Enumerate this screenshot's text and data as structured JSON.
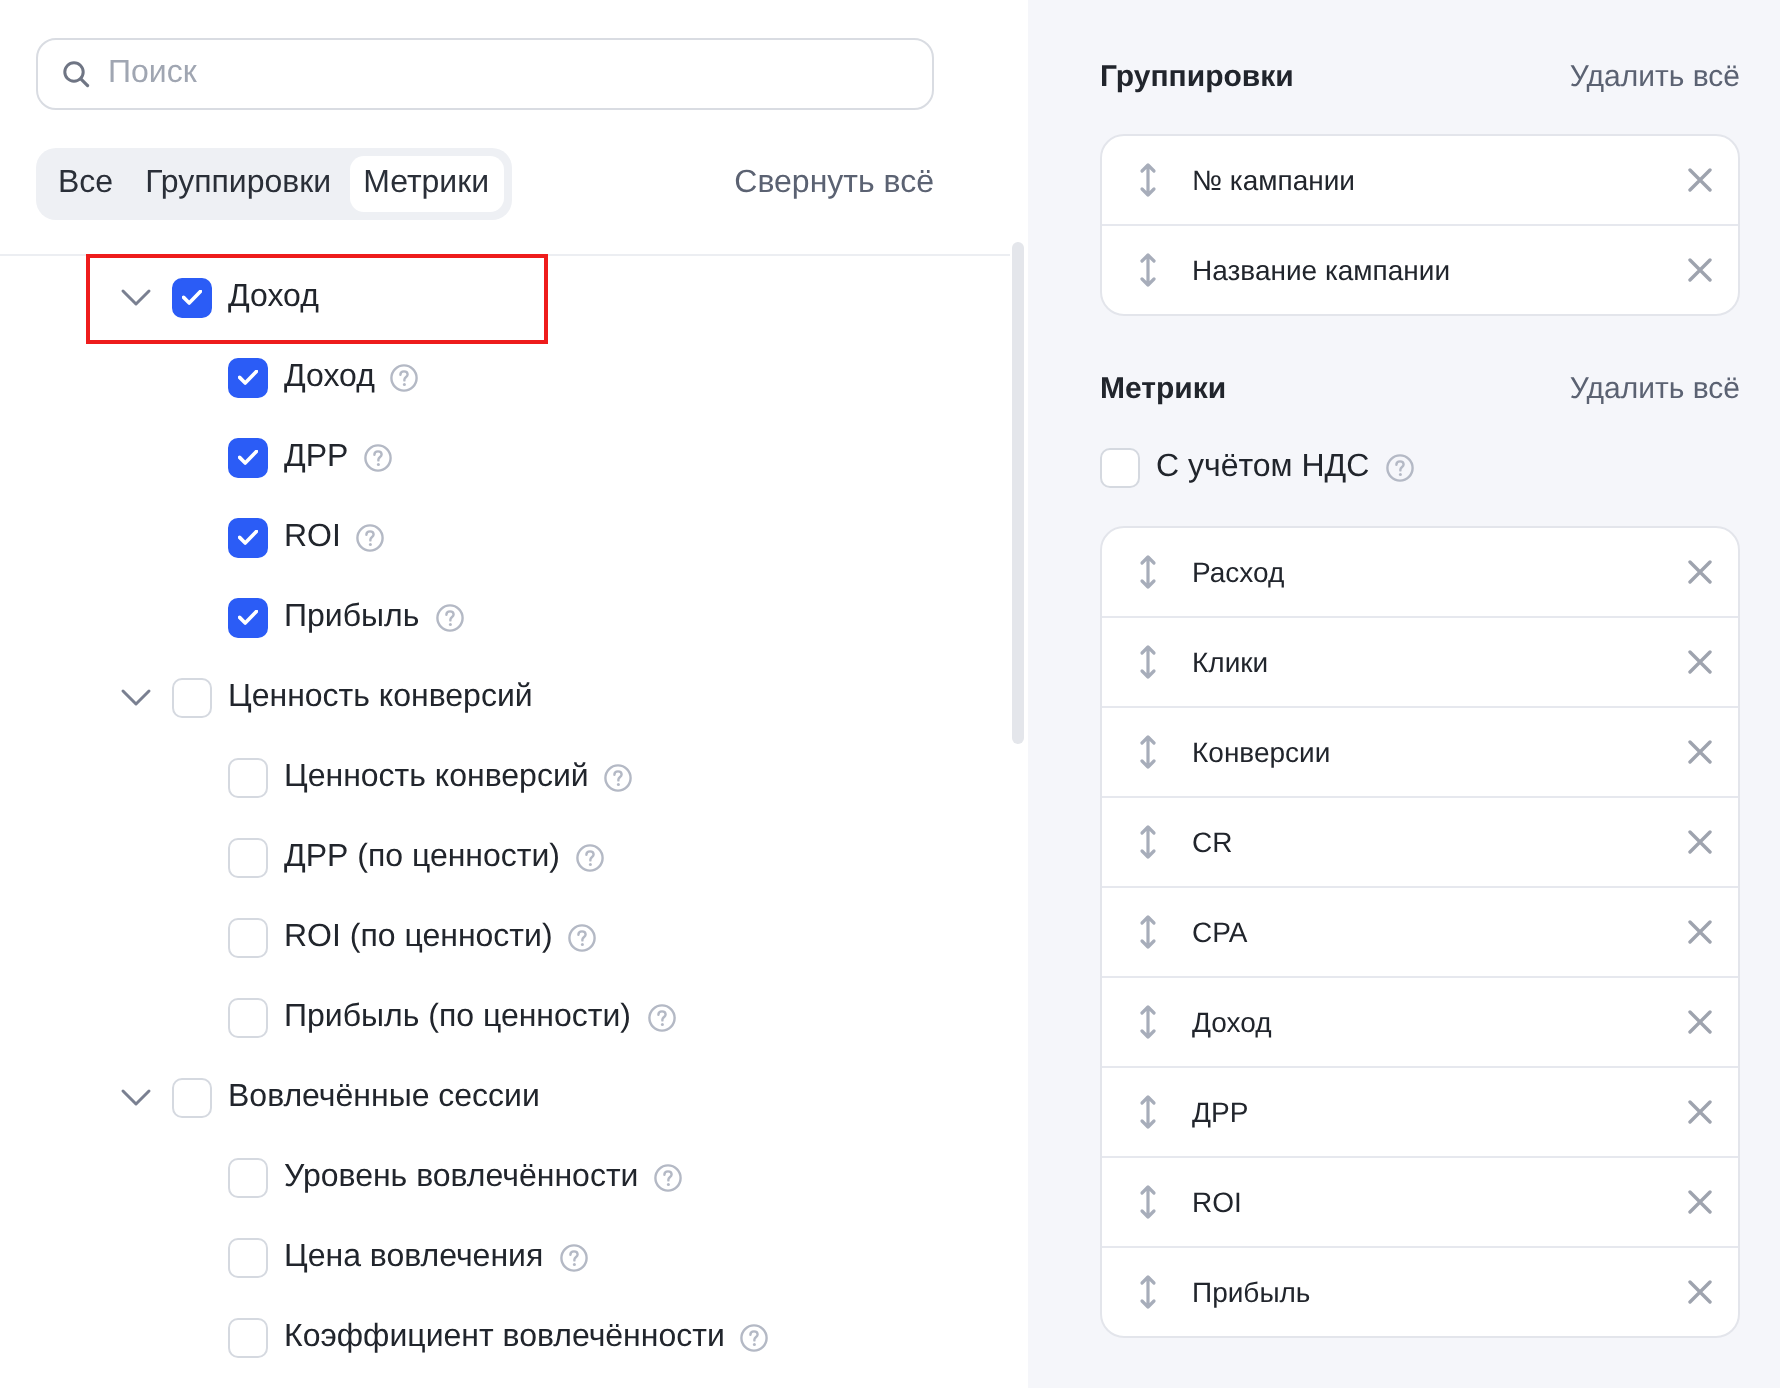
{
  "search": {
    "placeholder": "Поиск"
  },
  "tabs": [
    {
      "label": "Все",
      "selected": false
    },
    {
      "label": "Группировки",
      "selected": false
    },
    {
      "label": "Метрики",
      "selected": true
    }
  ],
  "collapse_all": "Свернуть всё",
  "tree": [
    {
      "label": "Доход",
      "checked": true,
      "expanded": true,
      "highlighted": true,
      "children": [
        {
          "label": "Доход",
          "checked": true
        },
        {
          "label": "ДРР",
          "checked": true
        },
        {
          "label": "ROI",
          "checked": true
        },
        {
          "label": "Прибыль",
          "checked": true
        }
      ]
    },
    {
      "label": "Ценность конверсий",
      "checked": false,
      "expanded": true,
      "highlighted": false,
      "children": [
        {
          "label": "Ценность конверсий",
          "checked": false
        },
        {
          "label": "ДРР (по ценности)",
          "checked": false
        },
        {
          "label": "ROI (по ценности)",
          "checked": false
        },
        {
          "label": "Прибыль (по ценности)",
          "checked": false
        }
      ]
    },
    {
      "label": "Вовлечённые сессии",
      "checked": false,
      "expanded": true,
      "highlighted": false,
      "children": [
        {
          "label": "Уровень вовлечённости",
          "checked": false
        },
        {
          "label": "Цена вовлечения",
          "checked": false
        },
        {
          "label": "Коэффициент вовлечённости",
          "checked": false
        }
      ]
    }
  ],
  "groupings": {
    "title": "Группировки",
    "clear": "Удалить всё",
    "items": [
      "№ кампании",
      "Название кампании"
    ]
  },
  "metrics": {
    "title": "Метрики",
    "clear": "Удалить всё",
    "vat": {
      "label": "С учётом НДС",
      "checked": false
    },
    "items": [
      "Расход",
      "Клики",
      "Конверсии",
      "CR",
      "CPA",
      "Доход",
      "ДРР",
      "ROI",
      "Прибыль"
    ]
  }
}
